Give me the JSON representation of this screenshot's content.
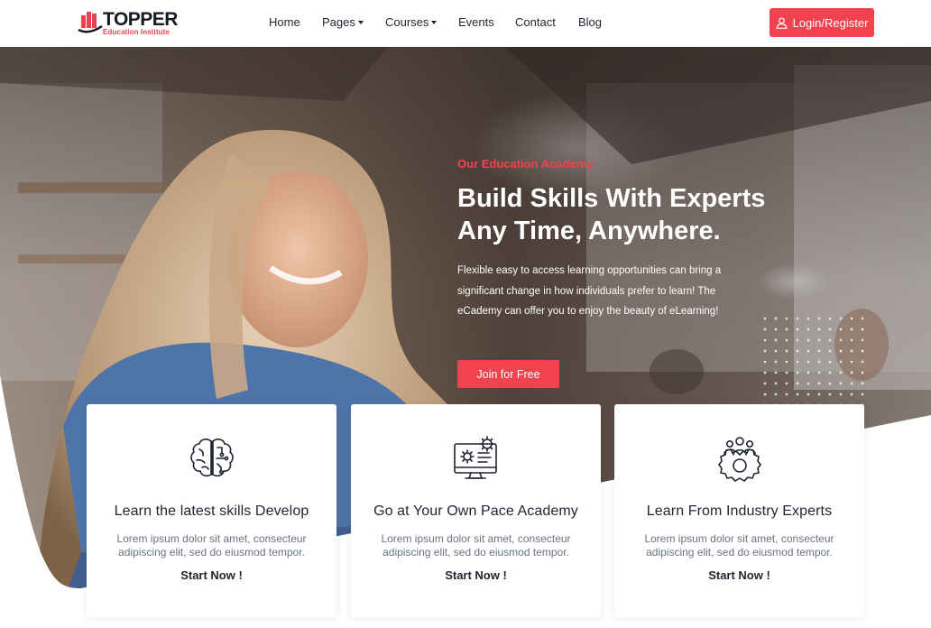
{
  "brand": {
    "name": "TOPPER",
    "tagline": "Education Institute",
    "accent": "#f1424f"
  },
  "nav": {
    "items": [
      {
        "label": "Home"
      },
      {
        "label": "Pages"
      },
      {
        "label": "Courses"
      },
      {
        "label": "Events"
      },
      {
        "label": "Contact"
      },
      {
        "label": "Blog"
      }
    ],
    "login_label": "Login/Register",
    "login_icon": "user-icon"
  },
  "hero": {
    "eyebrow": "Our Education Academy",
    "headline_line1": "Build Skills With Experts",
    "headline_line2": "Any Time, Anywhere.",
    "description": "Flexible easy to access learning opportunities can bring a significant change in how individuals prefer to learn! The eCademy can offer you to enjoy the beauty of eLearning!",
    "cta_label": "Join for Free"
  },
  "features": [
    {
      "icon": "brain-icon",
      "title": "Learn the latest skills Develop",
      "text": "Lorem ipsum dolor sit amet, consecteur adipiscing elit, sed do eiusmod tempor.",
      "cta": "Start Now !"
    },
    {
      "icon": "computer-gears-icon",
      "title": "Go at Your Own Pace Academy",
      "text": "Lorem ipsum dolor sit amet, consecteur adipiscing elit, sed do eiusmod tempor.",
      "cta": "Start Now !"
    },
    {
      "icon": "team-gear-icon",
      "title": "Learn From Industry Experts",
      "text": "Lorem ipsum dolor sit amet, consecteur adipiscing elit, sed do eiusmod tempor.",
      "cta": "Start Now !"
    }
  ]
}
